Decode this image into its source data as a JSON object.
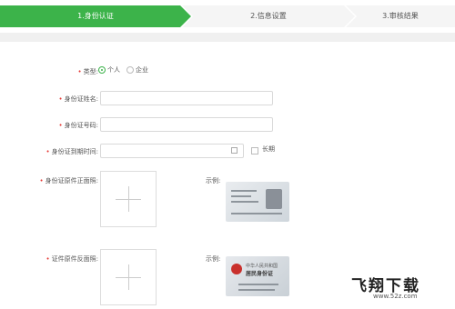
{
  "steps": [
    {
      "label": "1.身份认证",
      "active": true
    },
    {
      "label": "2.信息设置",
      "active": false
    },
    {
      "label": "3.审核结果",
      "active": false
    }
  ],
  "form": {
    "type_label": "类型:",
    "type_options": [
      "个人",
      "企业"
    ],
    "type_selected": "个人",
    "name_label": "身份证姓名:",
    "name_value": "",
    "id_label": "身份证号码:",
    "id_value": "",
    "expiry_label": "身份证到期时间:",
    "expiry_value": "",
    "longterm_label": "长期",
    "longterm_checked": false,
    "front_label": "身份证原件正面照:",
    "back_label": "证件原件反面照:",
    "example_label": "示例:"
  },
  "sample_card_back": {
    "line1": "中华人民共和国",
    "line2": "居民身份证"
  },
  "watermark": {
    "logo": "飞翔下载",
    "url": "www.52z.com"
  },
  "colors": {
    "accent": "#3cb34a",
    "required": "#e53935"
  }
}
